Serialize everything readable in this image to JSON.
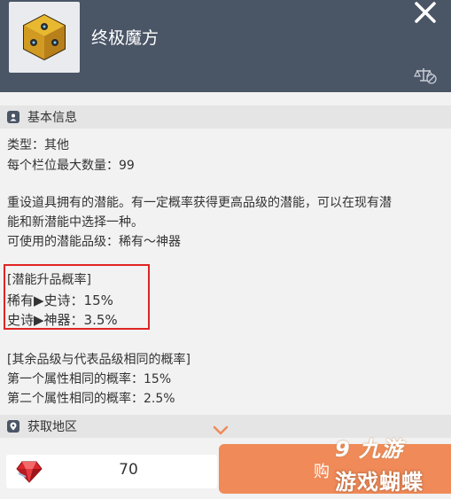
{
  "header": {
    "title": "终极魔方",
    "item_icon": "cube-icon",
    "close_icon": "close-icon",
    "compare_icon": "scale-icon"
  },
  "basic_info": {
    "section_label": "基本信息",
    "type_line": "类型：其他",
    "stack_line": "每个栏位最大数量：99",
    "desc_line1": "重设道具拥有的潜能。有一定概率获得更高品级的潜能，可以在现有潜",
    "desc_line2": "能和新潜能中选择一种。",
    "grade_line": "可使用的潜能品级：稀有～神器",
    "upgrade_title": "[潜能升品概率]",
    "upgrade_rare_epic": "稀有▶史诗：15%",
    "upgrade_epic_legend": "史诗▶神器：3.5%",
    "other_title": "[其余品级与代表品级相同的概率]",
    "other_first": "第一个属性相同的概率：15%",
    "other_second": "第二个属性相同的概率：2.5%"
  },
  "acquire": {
    "section_label": "获取地区"
  },
  "purchase": {
    "currency_icon": "red-gem-icon",
    "price": "70",
    "buy_label": "购"
  },
  "watermark": {
    "logo": "9 九游",
    "text": "游戏蝴蝶"
  },
  "colors": {
    "header_bg": "#4a5566",
    "buy_button": "#f08a58",
    "highlight_border": "#e02424"
  }
}
